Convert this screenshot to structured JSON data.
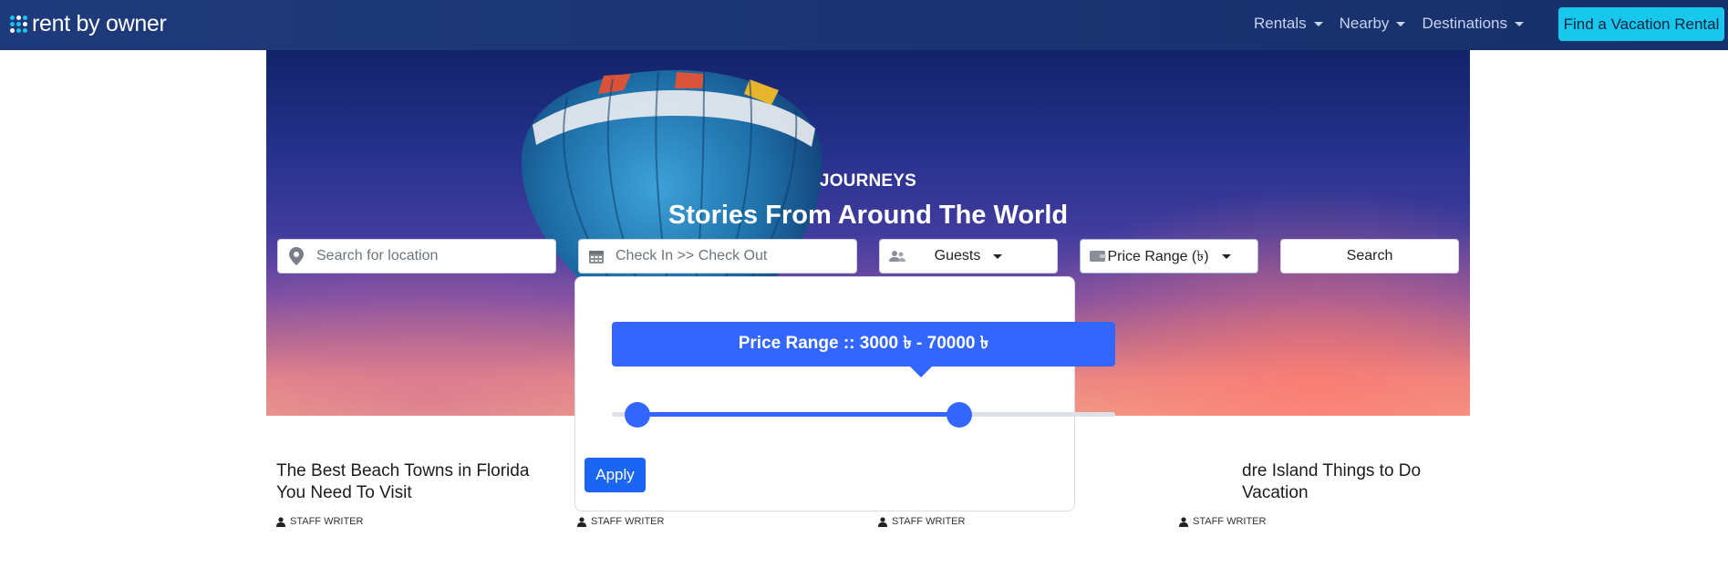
{
  "brand": {
    "name": "rent by owner",
    "dot_colors": [
      "#19c4e8",
      "#ffffff",
      "#19c4e8",
      "#19c4e8",
      "#19c4e8",
      "#ffffff",
      "#ffffff",
      "#19c4e8",
      "#19c4e8"
    ]
  },
  "nav": {
    "items": [
      {
        "label": "Rentals"
      },
      {
        "label": "Nearby"
      },
      {
        "label": "Destinations"
      }
    ],
    "cta_label": "Find a Vacation Rental"
  },
  "hero": {
    "kicker": "JOURNEYS",
    "title": "Stories From Around The World"
  },
  "search": {
    "location_placeholder": "Search for location",
    "dates_placeholder": "Check In >> Check Out",
    "guests_label": "Guests",
    "price_label": "Price Range (৳)",
    "search_label": "Search"
  },
  "price_popup": {
    "title": "Price Range :: 3000 ৳ - 70000 ৳",
    "min_value": 3000,
    "max_value": 70000,
    "slider_min_fraction": 0.05,
    "slider_max_fraction": 0.69,
    "apply_label": "Apply"
  },
  "articles": [
    {
      "title_line1": "The Best Beach Towns in Florida",
      "title_line2": "You Need To Visit",
      "author": "STAFF WRITER"
    },
    {
      "author": "STAFF WRITER"
    },
    {
      "author": "STAFF WRITER"
    },
    {
      "title_line1": "dre Island Things to Do",
      "title_line2": "Vacation",
      "author": "STAFF WRITER"
    }
  ],
  "colors": {
    "accent": "#3366ff",
    "nav_bg": "#16306b",
    "cta": "#18c7ec"
  }
}
